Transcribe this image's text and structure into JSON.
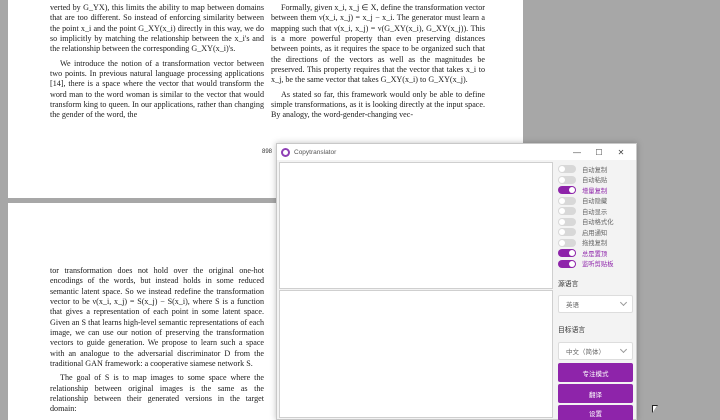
{
  "pdf": {
    "page1_left": [
      "verted by G_YX), this limits the ability to map between domains that are too different. So instead of enforcing similarity between the point x_i and the point G_XY(x_i) directly in this way, we do so implicitly by matching the relationship between the x_i's and the relationship between the corresponding G_XY(x_i)'s.",
      "We introduce the notion of a transformation vector between two points. In previous natural language processing applications [14], there is a space where the vector that would transform the word man to the word woman is similar to the vector that would transform king to queen. In our applications, rather than changing the gender of the word, the"
    ],
    "page1_right": [
      "Formally, given x_i, x_j ∈ X, define the transformation vector between them ν(x_i, x_j) = x_j − x_i. The generator must learn a mapping such that ν(x_i, x_j) = ν(G_XY(x_i), G_XY(x_j)). This is a more powerful property than even preserving distances between points, as it requires the space to be organized such that the directions of the vectors as well as the magnitudes be preserved. This property requires that the vector that takes x_i to x_j, be the same vector that takes G_XY(x_i) to G_XY(x_j).",
      "As stated so far, this framework would only be able to define simple transformations, as it is looking directly at the input space. By analogy, the word-gender-changing vec-"
    ],
    "page_number": "898",
    "page2_left": [
      "tor transformation does not hold over the original one-hot encodings of the words, but instead holds in some reduced semantic latent space. So we instead redefine the transformation vector to be ν(x_i, x_j) = S(x_j) − S(x_i), where S is a function that gives a representation of each point in some latent space. Given an S that learns high-level semantic representations of each image, we can use our notion of preserving the transformation vectors to guide generation. We propose to learn such a space with an analogue to the adversarial discriminator D from the traditional GAN framework: a cooperative siamese network S.",
      "The goal of S is to map images to some space where the relationship between original images is the same as the relationship between their generated versions in the target domain:"
    ]
  },
  "app": {
    "title": "Copytranslator",
    "controls": {
      "minimize": "—",
      "maximize": "☐",
      "close": "✕"
    },
    "options": [
      {
        "label": "自动复制",
        "on": false
      },
      {
        "label": "自动粘贴",
        "on": false
      },
      {
        "label": "增量复制",
        "on": true
      },
      {
        "label": "自动隐藏",
        "on": false
      },
      {
        "label": "自动显示",
        "on": false
      },
      {
        "label": "自动格式化",
        "on": false
      },
      {
        "label": "启用通知",
        "on": false
      },
      {
        "label": "拖拽复制",
        "on": false
      },
      {
        "label": "总是置顶",
        "on": true
      },
      {
        "label": "监听剪贴板",
        "on": true
      }
    ],
    "source_language_label": "源语言",
    "source_language_value": "英语",
    "target_language_label": "目标语言",
    "target_language_value": "中文（简体）",
    "focus_mode_label": "专注模式",
    "translate_label": "翻译",
    "settings_label": "设置",
    "accent_color": "#8e24aa"
  }
}
